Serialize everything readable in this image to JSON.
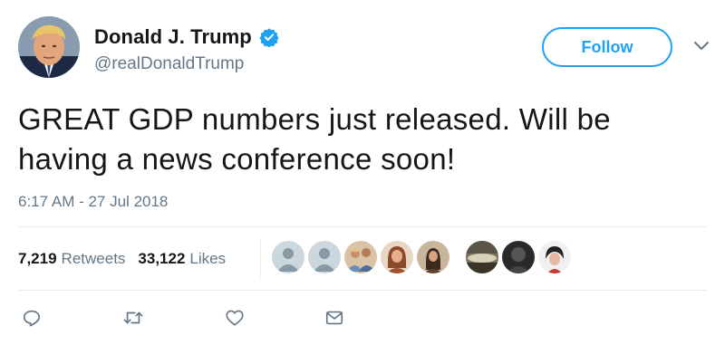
{
  "tweet": {
    "author": {
      "name": "Donald J. Trump",
      "handle": "@realDonaldTrump",
      "verified": true
    },
    "follow_label": "Follow",
    "text_line_1": "GREAT GDP numbers just released. Will be",
    "text_line_2": "having a news conference soon!",
    "timestamp": "6:17 AM - 27 Jul 2018",
    "stats": {
      "retweets_count": "7,219",
      "retweets_label": "Retweets",
      "likes_count": "33,122",
      "likes_label": "Likes"
    },
    "liker_avatar_count": 8,
    "colors": {
      "accent": "#1da1f2",
      "secondary_text": "#657786",
      "primary_text": "#14171a",
      "divider": "#e6ecf0"
    },
    "icons": [
      "verified-badge-icon",
      "chevron-down-icon",
      "reply-icon",
      "retweet-icon",
      "like-icon",
      "direct-message-icon"
    ]
  }
}
